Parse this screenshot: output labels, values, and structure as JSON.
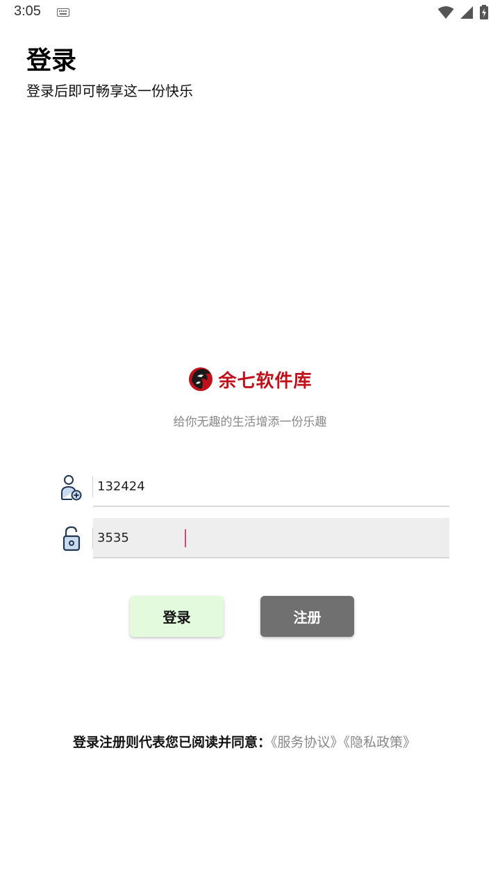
{
  "status_bar": {
    "time": "3:05"
  },
  "header": {
    "title": "登录",
    "subtitle": "登录后即可畅享这一份快乐"
  },
  "brand": {
    "name": "余七软件库",
    "slogan": "给你无趣的生活增添一份乐趣",
    "color": "#c0101a"
  },
  "form": {
    "username": {
      "value": "132424",
      "icon": "user-add-icon"
    },
    "password": {
      "value": "3535",
      "icon": "unlock-icon"
    }
  },
  "buttons": {
    "login_label": "登录",
    "register_label": "注册"
  },
  "agreement": {
    "text": "登录注册则代表您已阅读并同意：",
    "service_link": "《服务协议》",
    "privacy_link": "《隐私政策》"
  }
}
